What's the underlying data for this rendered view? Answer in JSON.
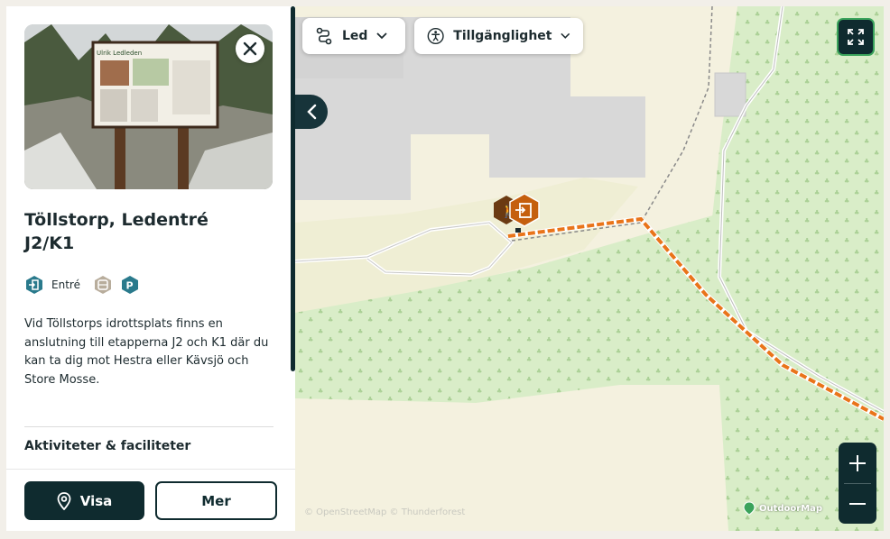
{
  "panel": {
    "title": "Töllstorp, Ledentré J2/K1",
    "tags": [
      {
        "icon": "entrance-icon",
        "label": "Entré",
        "color": "#2a7a8c"
      },
      {
        "icon": "toilet-icon",
        "label": "",
        "color": "#b8ad9c"
      },
      {
        "icon": "parking-icon",
        "label": "",
        "color": "#2a7a8c"
      }
    ],
    "description": "Vid Töllstorps idrottsplats finns en anslutning till etapperna J2 och K1 där du kan ta dig mot Hestra eller Kävsjö och Store Mosse.",
    "section_heading": "Aktiviteter & faciliteter",
    "buttons": {
      "visa": "Visa",
      "mer": "Mer"
    },
    "photo_sign_text": "Ulrik Ledleden"
  },
  "map": {
    "filters": [
      {
        "label": "Led",
        "icon": "route-icon"
      },
      {
        "label": "Tillgänglighet",
        "icon": "accessibility-icon"
      }
    ],
    "attribution": "© OpenStreetMap © Thunderforest",
    "provider": "OutdoorMap",
    "colors": {
      "trail": "#e9741a",
      "forest": "#d7ecc7",
      "building": "#d9d9d9",
      "ground": "#f4f1e0",
      "accent": "#0f2b2f",
      "marker": "#c55f0e"
    }
  }
}
